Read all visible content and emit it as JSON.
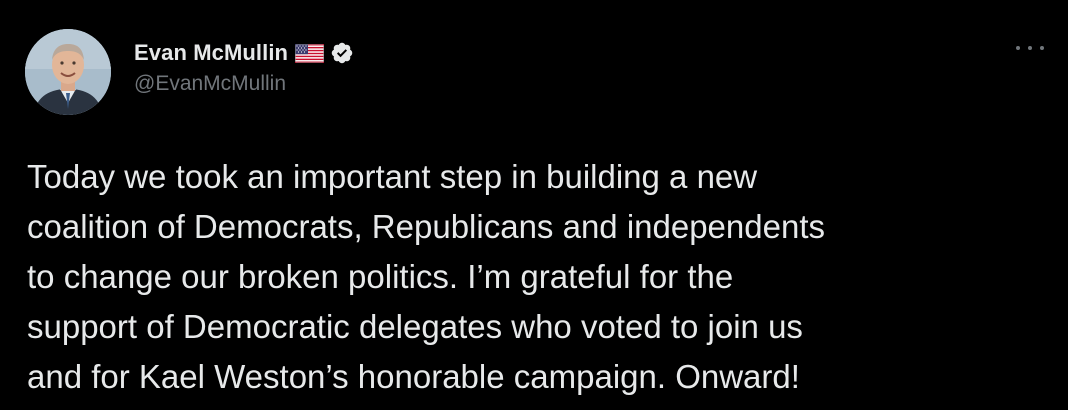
{
  "author": {
    "display_name": "Evan McMullin",
    "handle": "@EvanMcMullin",
    "flag_icon": "us-flag-icon",
    "verified_icon": "verified-badge-icon"
  },
  "tweet": {
    "lines": [
      "Today we took an important step in building a new",
      "coalition of Democrats, Republicans and independents",
      "to change our broken politics. I’m grateful for the",
      "support of Democratic delegates who voted to join us",
      "and for Kael Weston’s honorable campaign. Onward!"
    ]
  },
  "colors": {
    "background": "#000000",
    "text_primary": "#e7e9ea",
    "text_secondary": "#71767b"
  }
}
